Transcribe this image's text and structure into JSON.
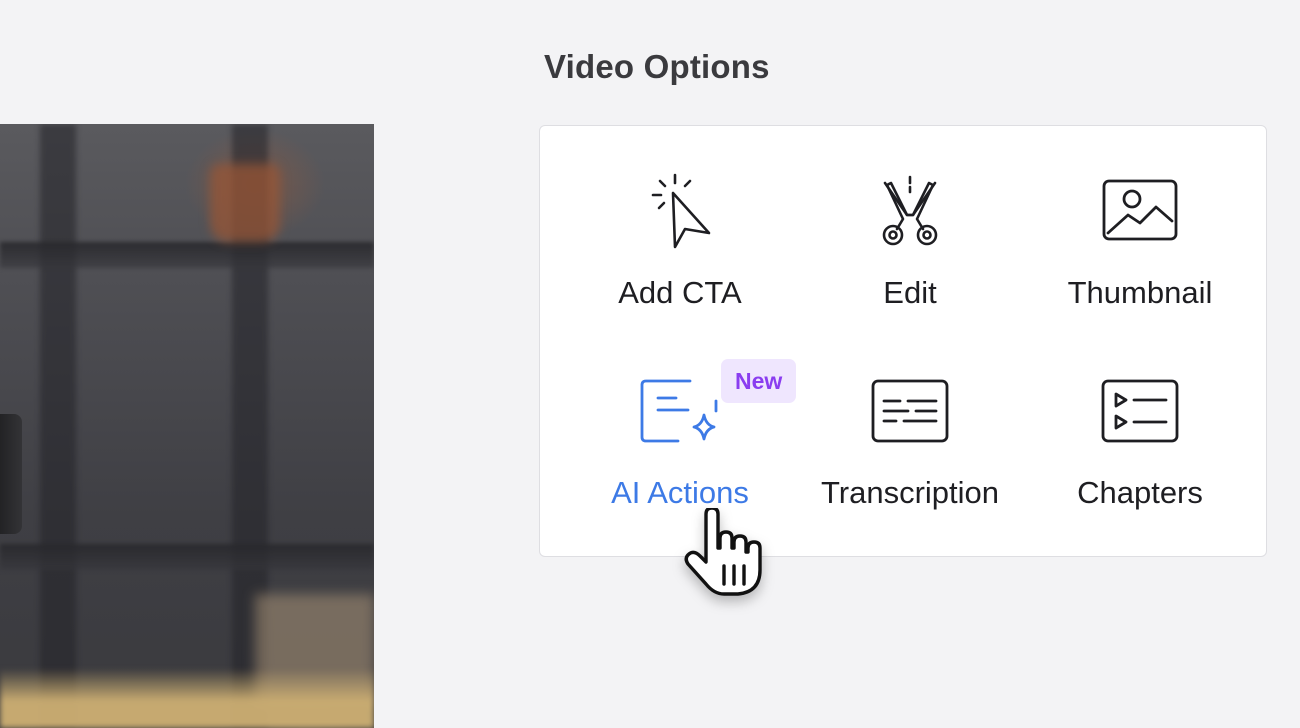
{
  "section": {
    "title": "Video Options"
  },
  "options": [
    {
      "label": "Add CTA",
      "icon": "cursor-click-icon"
    },
    {
      "label": "Edit",
      "icon": "scissors-icon"
    },
    {
      "label": "Thumbnail",
      "icon": "image-icon"
    },
    {
      "label": "AI Actions",
      "icon": "ai-sparkle-icon",
      "badge": "New",
      "state": "hover"
    },
    {
      "label": "Transcription",
      "icon": "captions-icon"
    },
    {
      "label": "Chapters",
      "icon": "chapters-list-icon"
    }
  ],
  "colors": {
    "accent_blue": "#3d7ae6",
    "badge_text": "#8a3df0",
    "badge_bg": "#efe6fe",
    "page_bg": "#f3f3f5"
  },
  "cursor": "hand-pointer-icon"
}
